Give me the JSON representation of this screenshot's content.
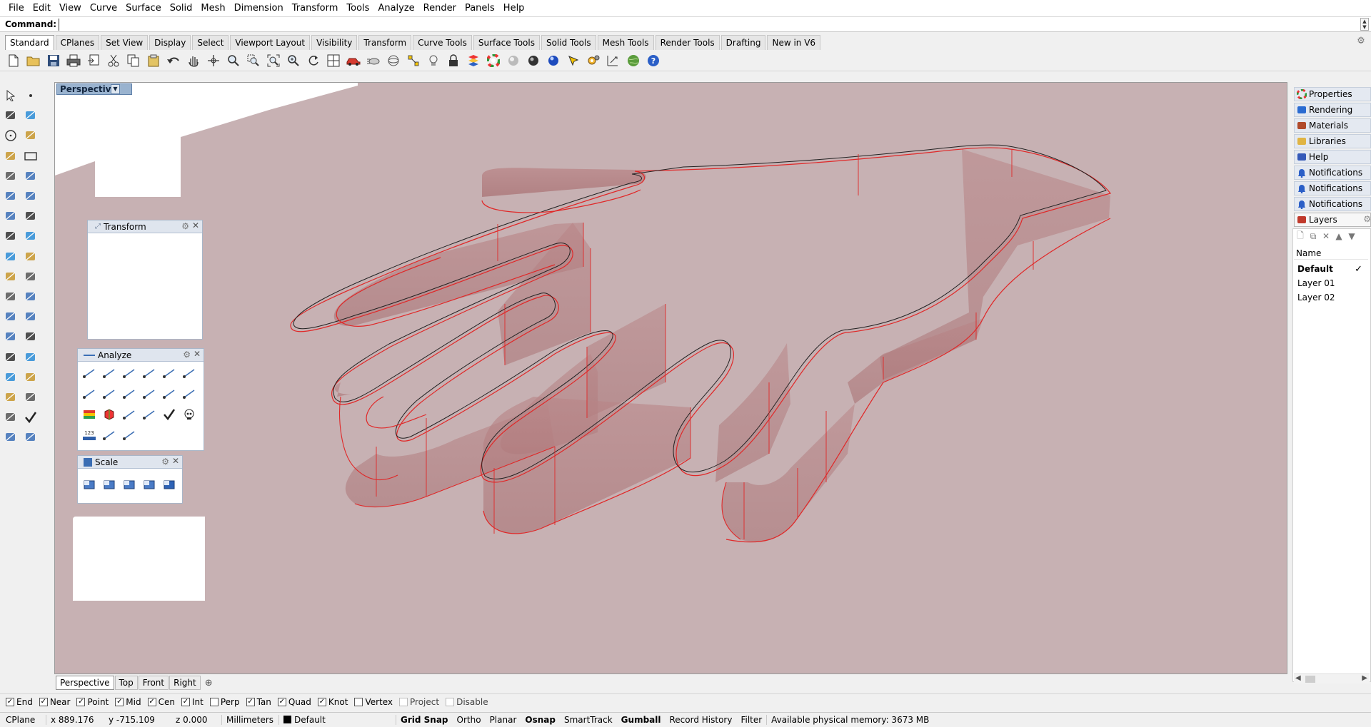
{
  "menu": [
    "File",
    "Edit",
    "View",
    "Curve",
    "Surface",
    "Solid",
    "Mesh",
    "Dimension",
    "Transform",
    "Tools",
    "Analyze",
    "Render",
    "Panels",
    "Help"
  ],
  "command": {
    "label": "Command:",
    "value": ""
  },
  "toolbar_tabs": [
    "Standard",
    "CPlanes",
    "Set View",
    "Display",
    "Select",
    "Viewport Layout",
    "Visibility",
    "Transform",
    "Curve Tools",
    "Surface Tools",
    "Solid Tools",
    "Mesh Tools",
    "Render Tools",
    "Drafting",
    "New in V6"
  ],
  "active_toolbar_tab": "Standard",
  "viewport": {
    "title": "Perspective",
    "bg_color": "#c7b1b3",
    "object_color": "#e52a2a"
  },
  "floating_panels": {
    "transform": {
      "title": "Transform"
    },
    "analyze": {
      "title": "Analyze"
    },
    "scale": {
      "title": "Scale"
    }
  },
  "viewport_tabs": [
    "Perspective",
    "Top",
    "Front",
    "Right"
  ],
  "active_viewport_tab": "Perspective",
  "osnaps": [
    {
      "label": "End",
      "checked": true
    },
    {
      "label": "Near",
      "checked": true
    },
    {
      "label": "Point",
      "checked": true
    },
    {
      "label": "Mid",
      "checked": true
    },
    {
      "label": "Cen",
      "checked": true
    },
    {
      "label": "Int",
      "checked": true
    },
    {
      "label": "Perp",
      "checked": false
    },
    {
      "label": "Tan",
      "checked": true
    },
    {
      "label": "Quad",
      "checked": true
    },
    {
      "label": "Knot",
      "checked": true
    },
    {
      "label": "Vertex",
      "checked": false
    },
    {
      "label": "Project",
      "checked": false,
      "disabled": true
    },
    {
      "label": "Disable",
      "checked": false,
      "disabled": true
    }
  ],
  "status": {
    "cplane": "CPlane",
    "x": "x 889.176",
    "y": "y -715.109",
    "z": "z 0.000",
    "units": "Millimeters",
    "layer": "Default",
    "toggles": [
      {
        "label": "Grid Snap",
        "bold": true
      },
      {
        "label": "Ortho",
        "bold": false
      },
      {
        "label": "Planar",
        "bold": false
      },
      {
        "label": "Osnap",
        "bold": true
      },
      {
        "label": "SmartTrack",
        "bold": false
      },
      {
        "label": "Gumball",
        "bold": true
      },
      {
        "label": "Record History",
        "bold": false
      },
      {
        "label": "Filter",
        "bold": false
      }
    ],
    "memory": "Available physical memory: 3673 MB"
  },
  "right_panel": {
    "tabs": [
      "Properties",
      "Rendering",
      "Materials",
      "Libraries",
      "Help",
      "Notifications",
      "Notifications",
      "Notifications",
      "Layers"
    ],
    "active_tab": "Layers"
  },
  "layers": {
    "header": "Name",
    "rows": [
      {
        "name": "Default",
        "current": true
      },
      {
        "name": "Layer 01",
        "current": false
      },
      {
        "name": "Layer 02",
        "current": false
      }
    ]
  },
  "icons": {
    "standard_toolbar": [
      "new-icon",
      "open-icon",
      "save-icon",
      "print-icon",
      "import-icon",
      "cut-icon",
      "copy-icon",
      "paste-icon",
      "undo-icon",
      "pan-icon",
      "rotate-view-icon",
      "zoom-icon",
      "zoom-window-icon",
      "zoom-extents-icon",
      "zoom-selected-icon",
      "rotate-icon",
      "four-view-icon",
      "car-icon",
      "motion-icon",
      "rotate-3d-icon",
      "snap-select-icon",
      "light-icon",
      "lock-icon",
      "layer-icon",
      "color-wheel-icon",
      "material-ball-icon",
      "material-ball-dark-icon",
      "render-sphere-icon",
      "cursor-pen-icon",
      "gear-options-icon",
      "dimension-icon",
      "globe-icon",
      "help-icon"
    ]
  }
}
